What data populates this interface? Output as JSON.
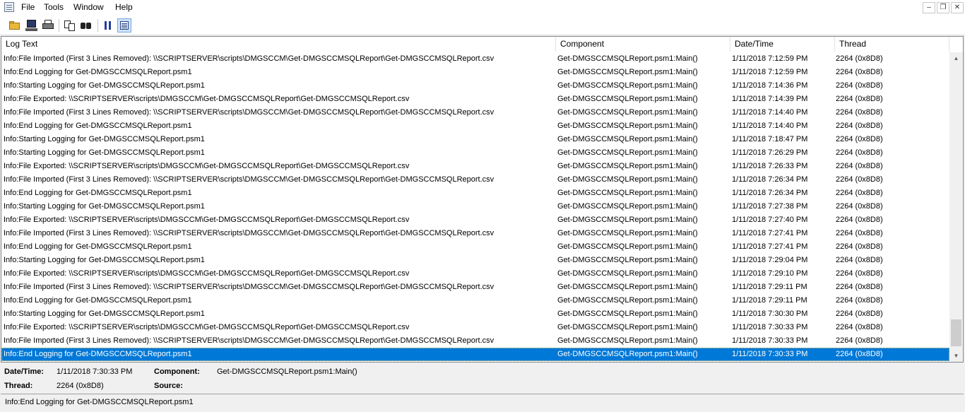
{
  "menu": {
    "file": "File",
    "tools": "Tools",
    "window": "Window",
    "help": "Help"
  },
  "window_controls": {
    "minimize": "–",
    "restore": "❐",
    "close": "✕"
  },
  "toolbar": {
    "buttons": [
      "open-folder-icon",
      "open-network-icon",
      "print-icon",
      "copy-icon",
      "find-icon",
      "pause-icon",
      "details-pane-icon"
    ]
  },
  "columns": {
    "log_text": "Log Text",
    "component": "Component",
    "datetime": "Date/Time",
    "thread": "Thread"
  },
  "rows": [
    {
      "text": "Info:File Imported (First 3 Lines Removed): \\\\SCRIPTSERVER\\scripts\\DMGSCCM\\Get-DMGSCCMSQLReport\\Get-DMGSCCMSQLReport.csv",
      "component": "Get-DMGSCCMSQLReport.psm1:Main()",
      "datetime": "1/11/2018 7:12:59 PM",
      "thread": "2264 (0x8D8)"
    },
    {
      "text": "Info:End Logging for Get-DMGSCCMSQLReport.psm1",
      "component": "Get-DMGSCCMSQLReport.psm1:Main()",
      "datetime": "1/11/2018 7:12:59 PM",
      "thread": "2264 (0x8D8)"
    },
    {
      "text": "Info:Starting Logging for Get-DMGSCCMSQLReport.psm1",
      "component": "Get-DMGSCCMSQLReport.psm1:Main()",
      "datetime": "1/11/2018 7:14:36 PM",
      "thread": "2264 (0x8D8)"
    },
    {
      "text": "Info:File Exported: \\\\SCRIPTSERVER\\scripts\\DMGSCCM\\Get-DMGSCCMSQLReport\\Get-DMGSCCMSQLReport.csv",
      "component": "Get-DMGSCCMSQLReport.psm1:Main()",
      "datetime": "1/11/2018 7:14:39 PM",
      "thread": "2264 (0x8D8)"
    },
    {
      "text": "Info:File Imported (First 3 Lines Removed): \\\\SCRIPTSERVER\\scripts\\DMGSCCM\\Get-DMGSCCMSQLReport\\Get-DMGSCCMSQLReport.csv",
      "component": "Get-DMGSCCMSQLReport.psm1:Main()",
      "datetime": "1/11/2018 7:14:40 PM",
      "thread": "2264 (0x8D8)"
    },
    {
      "text": "Info:End Logging for Get-DMGSCCMSQLReport.psm1",
      "component": "Get-DMGSCCMSQLReport.psm1:Main()",
      "datetime": "1/11/2018 7:14:40 PM",
      "thread": "2264 (0x8D8)"
    },
    {
      "text": "Info:Starting Logging for Get-DMGSCCMSQLReport.psm1",
      "component": "Get-DMGSCCMSQLReport.psm1:Main()",
      "datetime": "1/11/2018 7:18:47 PM",
      "thread": "2264 (0x8D8)"
    },
    {
      "text": "Info:Starting Logging for Get-DMGSCCMSQLReport.psm1",
      "component": "Get-DMGSCCMSQLReport.psm1:Main()",
      "datetime": "1/11/2018 7:26:29 PM",
      "thread": "2264 (0x8D8)"
    },
    {
      "text": "Info:File Exported: \\\\SCRIPTSERVER\\scripts\\DMGSCCM\\Get-DMGSCCMSQLReport\\Get-DMGSCCMSQLReport.csv",
      "component": "Get-DMGSCCMSQLReport.psm1:Main()",
      "datetime": "1/11/2018 7:26:33 PM",
      "thread": "2264 (0x8D8)"
    },
    {
      "text": "Info:File Imported (First 3 Lines Removed): \\\\SCRIPTSERVER\\scripts\\DMGSCCM\\Get-DMGSCCMSQLReport\\Get-DMGSCCMSQLReport.csv",
      "component": "Get-DMGSCCMSQLReport.psm1:Main()",
      "datetime": "1/11/2018 7:26:34 PM",
      "thread": "2264 (0x8D8)"
    },
    {
      "text": "Info:End Logging for Get-DMGSCCMSQLReport.psm1",
      "component": "Get-DMGSCCMSQLReport.psm1:Main()",
      "datetime": "1/11/2018 7:26:34 PM",
      "thread": "2264 (0x8D8)"
    },
    {
      "text": "Info:Starting Logging for Get-DMGSCCMSQLReport.psm1",
      "component": "Get-DMGSCCMSQLReport.psm1:Main()",
      "datetime": "1/11/2018 7:27:38 PM",
      "thread": "2264 (0x8D8)"
    },
    {
      "text": "Info:File Exported: \\\\SCRIPTSERVER\\scripts\\DMGSCCM\\Get-DMGSCCMSQLReport\\Get-DMGSCCMSQLReport.csv",
      "component": "Get-DMGSCCMSQLReport.psm1:Main()",
      "datetime": "1/11/2018 7:27:40 PM",
      "thread": "2264 (0x8D8)"
    },
    {
      "text": "Info:File Imported (First 3 Lines Removed): \\\\SCRIPTSERVER\\scripts\\DMGSCCM\\Get-DMGSCCMSQLReport\\Get-DMGSCCMSQLReport.csv",
      "component": "Get-DMGSCCMSQLReport.psm1:Main()",
      "datetime": "1/11/2018 7:27:41 PM",
      "thread": "2264 (0x8D8)"
    },
    {
      "text": "Info:End Logging for Get-DMGSCCMSQLReport.psm1",
      "component": "Get-DMGSCCMSQLReport.psm1:Main()",
      "datetime": "1/11/2018 7:27:41 PM",
      "thread": "2264 (0x8D8)"
    },
    {
      "text": "Info:Starting Logging for Get-DMGSCCMSQLReport.psm1",
      "component": "Get-DMGSCCMSQLReport.psm1:Main()",
      "datetime": "1/11/2018 7:29:04 PM",
      "thread": "2264 (0x8D8)"
    },
    {
      "text": "Info:File Exported: \\\\SCRIPTSERVER\\scripts\\DMGSCCM\\Get-DMGSCCMSQLReport\\Get-DMGSCCMSQLReport.csv",
      "component": "Get-DMGSCCMSQLReport.psm1:Main()",
      "datetime": "1/11/2018 7:29:10 PM",
      "thread": "2264 (0x8D8)"
    },
    {
      "text": "Info:File Imported (First 3 Lines Removed): \\\\SCRIPTSERVER\\scripts\\DMGSCCM\\Get-DMGSCCMSQLReport\\Get-DMGSCCMSQLReport.csv",
      "component": "Get-DMGSCCMSQLReport.psm1:Main()",
      "datetime": "1/11/2018 7:29:11 PM",
      "thread": "2264 (0x8D8)"
    },
    {
      "text": "Info:End Logging for Get-DMGSCCMSQLReport.psm1",
      "component": "Get-DMGSCCMSQLReport.psm1:Main()",
      "datetime": "1/11/2018 7:29:11 PM",
      "thread": "2264 (0x8D8)"
    },
    {
      "text": "Info:Starting Logging for Get-DMGSCCMSQLReport.psm1",
      "component": "Get-DMGSCCMSQLReport.psm1:Main()",
      "datetime": "1/11/2018 7:30:30 PM",
      "thread": "2264 (0x8D8)"
    },
    {
      "text": "Info:File Exported: \\\\SCRIPTSERVER\\scripts\\DMGSCCM\\Get-DMGSCCMSQLReport\\Get-DMGSCCMSQLReport.csv",
      "component": "Get-DMGSCCMSQLReport.psm1:Main()",
      "datetime": "1/11/2018 7:30:33 PM",
      "thread": "2264 (0x8D8)"
    },
    {
      "text": "Info:File Imported (First 3 Lines Removed): \\\\SCRIPTSERVER\\scripts\\DMGSCCM\\Get-DMGSCCMSQLReport\\Get-DMGSCCMSQLReport.csv",
      "component": "Get-DMGSCCMSQLReport.psm1:Main()",
      "datetime": "1/11/2018 7:30:33 PM",
      "thread": "2264 (0x8D8)"
    },
    {
      "text": "Info:End Logging for Get-DMGSCCMSQLReport.psm1",
      "component": "Get-DMGSCCMSQLReport.psm1:Main()",
      "datetime": "1/11/2018 7:30:33 PM",
      "thread": "2264 (0x8D8)",
      "selected": true
    }
  ],
  "scrollbar": {
    "up_arrow": "▲",
    "down_arrow": "▼"
  },
  "details": {
    "datetime_label": "Date/Time:",
    "datetime_value": "1/11/2018 7:30:33 PM",
    "component_label": "Component:",
    "component_value": "Get-DMGSCCMSQLReport.psm1:Main()",
    "thread_label": "Thread:",
    "thread_value": "2264 (0x8D8)",
    "source_label": "Source:",
    "source_value": "",
    "message": "Info:End Logging for Get-DMGSCCMSQLReport.psm1"
  },
  "colors": {
    "selection": "#0078d7",
    "window_bg": "#f0f0f0"
  }
}
